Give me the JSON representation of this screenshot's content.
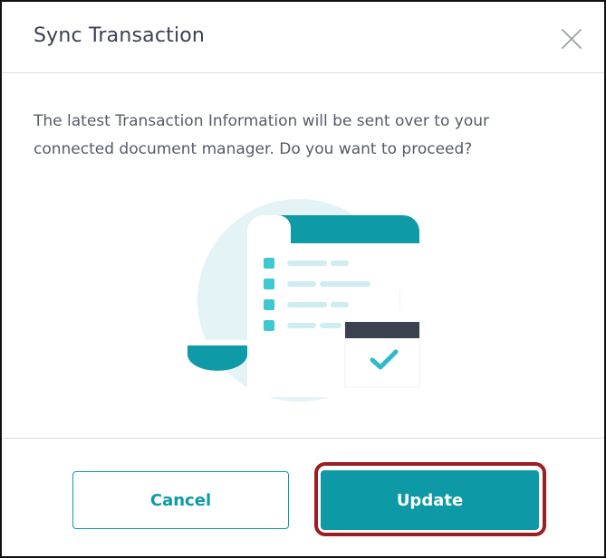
{
  "dialog": {
    "title": "Sync Transaction",
    "close_icon": "close-icon",
    "message_line1": "The latest Transaction Information will be sent over to your",
    "message_line2": "connected document manager. Do you want to proceed?",
    "illustration_icon": "document-sync-illustration",
    "cancel_label": "Cancel",
    "update_label": "Update"
  },
  "colors": {
    "accent": "#0d9aa6",
    "title_text": "#3b4150",
    "body_text": "#555b66",
    "highlight_border": "#9c1d22",
    "illustration_circle": "#e3f3f6",
    "illustration_dark": "#3b4150"
  }
}
